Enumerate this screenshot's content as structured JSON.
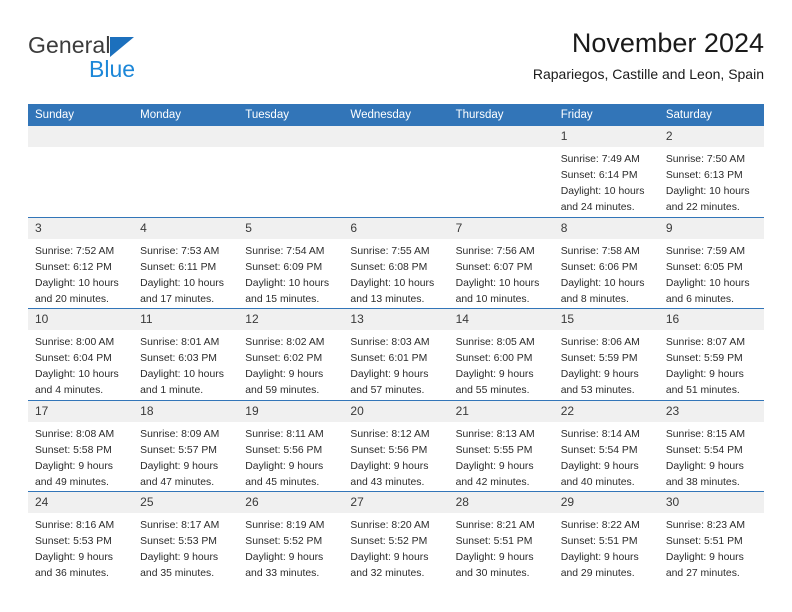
{
  "logo": {
    "word_top": "General",
    "word_bottom": "Blue",
    "triangle_color": "#1c70bd",
    "bottom_color": "#1c87d8",
    "top_color": "#3c3c3c"
  },
  "header": {
    "title": "November 2024",
    "subtitle": "Rapariegos, Castille and Leon, Spain"
  },
  "theme": {
    "header_bg": "#3275b8",
    "header_text": "#ffffff",
    "daynum_bg": "#f0f0f0",
    "cell_bg": "#ffffff",
    "rule_color": "#3275b8"
  },
  "weekday_headers": [
    "Sunday",
    "Monday",
    "Tuesday",
    "Wednesday",
    "Thursday",
    "Friday",
    "Saturday"
  ],
  "weeks": [
    [
      {
        "day": "",
        "empty": true
      },
      {
        "day": "",
        "empty": true
      },
      {
        "day": "",
        "empty": true
      },
      {
        "day": "",
        "empty": true
      },
      {
        "day": "",
        "empty": true
      },
      {
        "day": "1",
        "sunrise": "Sunrise: 7:49 AM",
        "sunset": "Sunset: 6:14 PM",
        "daylight": "Daylight: 10 hours and 24 minutes."
      },
      {
        "day": "2",
        "sunrise": "Sunrise: 7:50 AM",
        "sunset": "Sunset: 6:13 PM",
        "daylight": "Daylight: 10 hours and 22 minutes."
      }
    ],
    [
      {
        "day": "3",
        "sunrise": "Sunrise: 7:52 AM",
        "sunset": "Sunset: 6:12 PM",
        "daylight": "Daylight: 10 hours and 20 minutes."
      },
      {
        "day": "4",
        "sunrise": "Sunrise: 7:53 AM",
        "sunset": "Sunset: 6:11 PM",
        "daylight": "Daylight: 10 hours and 17 minutes."
      },
      {
        "day": "5",
        "sunrise": "Sunrise: 7:54 AM",
        "sunset": "Sunset: 6:09 PM",
        "daylight": "Daylight: 10 hours and 15 minutes."
      },
      {
        "day": "6",
        "sunrise": "Sunrise: 7:55 AM",
        "sunset": "Sunset: 6:08 PM",
        "daylight": "Daylight: 10 hours and 13 minutes."
      },
      {
        "day": "7",
        "sunrise": "Sunrise: 7:56 AM",
        "sunset": "Sunset: 6:07 PM",
        "daylight": "Daylight: 10 hours and 10 minutes."
      },
      {
        "day": "8",
        "sunrise": "Sunrise: 7:58 AM",
        "sunset": "Sunset: 6:06 PM",
        "daylight": "Daylight: 10 hours and 8 minutes."
      },
      {
        "day": "9",
        "sunrise": "Sunrise: 7:59 AM",
        "sunset": "Sunset: 6:05 PM",
        "daylight": "Daylight: 10 hours and 6 minutes."
      }
    ],
    [
      {
        "day": "10",
        "sunrise": "Sunrise: 8:00 AM",
        "sunset": "Sunset: 6:04 PM",
        "daylight": "Daylight: 10 hours and 4 minutes."
      },
      {
        "day": "11",
        "sunrise": "Sunrise: 8:01 AM",
        "sunset": "Sunset: 6:03 PM",
        "daylight": "Daylight: 10 hours and 1 minute."
      },
      {
        "day": "12",
        "sunrise": "Sunrise: 8:02 AM",
        "sunset": "Sunset: 6:02 PM",
        "daylight": "Daylight: 9 hours and 59 minutes."
      },
      {
        "day": "13",
        "sunrise": "Sunrise: 8:03 AM",
        "sunset": "Sunset: 6:01 PM",
        "daylight": "Daylight: 9 hours and 57 minutes."
      },
      {
        "day": "14",
        "sunrise": "Sunrise: 8:05 AM",
        "sunset": "Sunset: 6:00 PM",
        "daylight": "Daylight: 9 hours and 55 minutes."
      },
      {
        "day": "15",
        "sunrise": "Sunrise: 8:06 AM",
        "sunset": "Sunset: 5:59 PM",
        "daylight": "Daylight: 9 hours and 53 minutes."
      },
      {
        "day": "16",
        "sunrise": "Sunrise: 8:07 AM",
        "sunset": "Sunset: 5:59 PM",
        "daylight": "Daylight: 9 hours and 51 minutes."
      }
    ],
    [
      {
        "day": "17",
        "sunrise": "Sunrise: 8:08 AM",
        "sunset": "Sunset: 5:58 PM",
        "daylight": "Daylight: 9 hours and 49 minutes."
      },
      {
        "day": "18",
        "sunrise": "Sunrise: 8:09 AM",
        "sunset": "Sunset: 5:57 PM",
        "daylight": "Daylight: 9 hours and 47 minutes."
      },
      {
        "day": "19",
        "sunrise": "Sunrise: 8:11 AM",
        "sunset": "Sunset: 5:56 PM",
        "daylight": "Daylight: 9 hours and 45 minutes."
      },
      {
        "day": "20",
        "sunrise": "Sunrise: 8:12 AM",
        "sunset": "Sunset: 5:56 PM",
        "daylight": "Daylight: 9 hours and 43 minutes."
      },
      {
        "day": "21",
        "sunrise": "Sunrise: 8:13 AM",
        "sunset": "Sunset: 5:55 PM",
        "daylight": "Daylight: 9 hours and 42 minutes."
      },
      {
        "day": "22",
        "sunrise": "Sunrise: 8:14 AM",
        "sunset": "Sunset: 5:54 PM",
        "daylight": "Daylight: 9 hours and 40 minutes."
      },
      {
        "day": "23",
        "sunrise": "Sunrise: 8:15 AM",
        "sunset": "Sunset: 5:54 PM",
        "daylight": "Daylight: 9 hours and 38 minutes."
      }
    ],
    [
      {
        "day": "24",
        "sunrise": "Sunrise: 8:16 AM",
        "sunset": "Sunset: 5:53 PM",
        "daylight": "Daylight: 9 hours and 36 minutes."
      },
      {
        "day": "25",
        "sunrise": "Sunrise: 8:17 AM",
        "sunset": "Sunset: 5:53 PM",
        "daylight": "Daylight: 9 hours and 35 minutes."
      },
      {
        "day": "26",
        "sunrise": "Sunrise: 8:19 AM",
        "sunset": "Sunset: 5:52 PM",
        "daylight": "Daylight: 9 hours and 33 minutes."
      },
      {
        "day": "27",
        "sunrise": "Sunrise: 8:20 AM",
        "sunset": "Sunset: 5:52 PM",
        "daylight": "Daylight: 9 hours and 32 minutes."
      },
      {
        "day": "28",
        "sunrise": "Sunrise: 8:21 AM",
        "sunset": "Sunset: 5:51 PM",
        "daylight": "Daylight: 9 hours and 30 minutes."
      },
      {
        "day": "29",
        "sunrise": "Sunrise: 8:22 AM",
        "sunset": "Sunset: 5:51 PM",
        "daylight": "Daylight: 9 hours and 29 minutes."
      },
      {
        "day": "30",
        "sunrise": "Sunrise: 8:23 AM",
        "sunset": "Sunset: 5:51 PM",
        "daylight": "Daylight: 9 hours and 27 minutes."
      }
    ]
  ]
}
